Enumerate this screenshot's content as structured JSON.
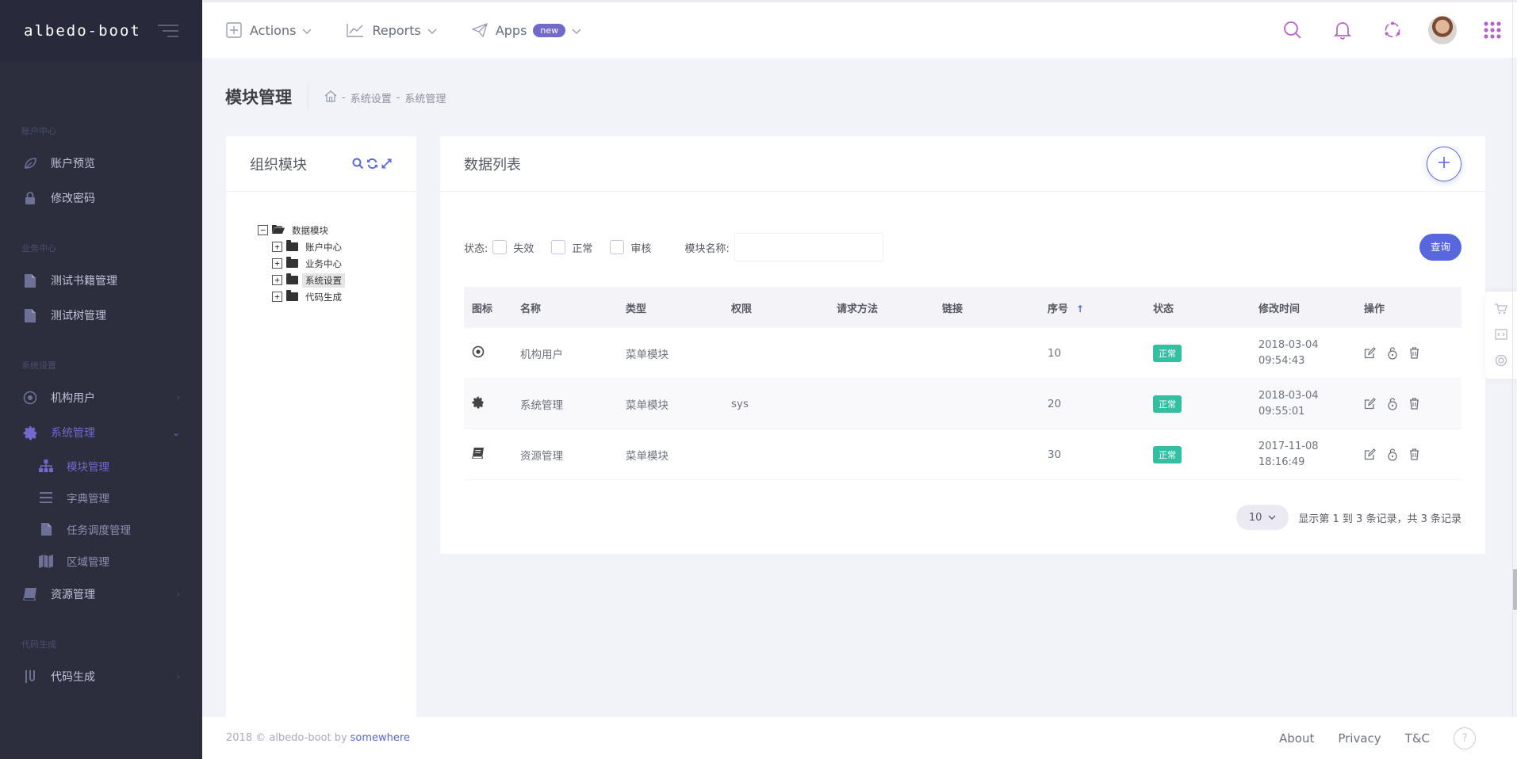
{
  "brand": {
    "name": "albedo-boot"
  },
  "sidebar": {
    "sections": [
      {
        "title": "账户中心",
        "items": [
          {
            "label": "账户预览",
            "icon": "leaf-icon"
          },
          {
            "label": "修改密码",
            "icon": "lock-icon"
          }
        ]
      },
      {
        "title": "业务中心",
        "items": [
          {
            "label": "测试书籍管理",
            "icon": "file-icon"
          },
          {
            "label": "测试树管理",
            "icon": "file-icon"
          }
        ]
      },
      {
        "title": "系统设置",
        "items": [
          {
            "label": "机构用户",
            "icon": "target-icon"
          },
          {
            "label": "系统管理",
            "icon": "gear-icon"
          }
        ]
      },
      {
        "title": "代码生成",
        "items": [
          {
            "label": "代码生成",
            "icon": "code-icon"
          }
        ]
      }
    ],
    "submenu": [
      {
        "label": "模块管理",
        "icon": "sitemap-icon"
      },
      {
        "label": "字典管理",
        "icon": "list-icon"
      },
      {
        "label": "任务调度管理",
        "icon": "file-icon"
      },
      {
        "label": "区域管理",
        "icon": "map-icon"
      }
    ],
    "resource": {
      "label": "资源管理",
      "icon": "book-icon"
    }
  },
  "header": {
    "menus": [
      {
        "label": "Actions",
        "icon": "add-square-icon"
      },
      {
        "label": "Reports",
        "icon": "chart-icon"
      },
      {
        "label": "Apps",
        "icon": "paper-plane-icon",
        "badge": "new"
      }
    ],
    "tools": [
      "search-icon",
      "bell-icon",
      "network-icon",
      "avatar",
      "apps-grid-icon"
    ]
  },
  "subheader": {
    "title": "模块管理",
    "crumbs": [
      "系统设置",
      "系统管理"
    ],
    "separator": "-"
  },
  "tree_panel": {
    "title": "组织模块",
    "root": {
      "label": "数据模块",
      "toggle": "−"
    },
    "children": [
      {
        "label": "账户中心",
        "toggle": "+"
      },
      {
        "label": "业务中心",
        "toggle": "+"
      },
      {
        "label": "系统设置",
        "toggle": "+"
      },
      {
        "label": "代码生成",
        "toggle": "+"
      }
    ]
  },
  "list_panel": {
    "title": "数据列表",
    "filters": {
      "status_label": "状态:",
      "options": [
        "失效",
        "正常",
        "审核"
      ],
      "name_label": "模块名称:",
      "name_value": "",
      "query_button": "查询"
    },
    "columns": [
      "图标",
      "名称",
      "类型",
      "权限",
      "请求方法",
      "链接",
      "序号",
      "状态",
      "修改时间",
      "操作"
    ],
    "rows": [
      {
        "icon": "dot-circle-icon",
        "name": "机构用户",
        "type": "菜单模块",
        "permission": "",
        "method": "",
        "link": "",
        "order": "10",
        "status": "正常",
        "time1": "2018-03-04",
        "time2": "09:54:43"
      },
      {
        "icon": "gear-icon",
        "name": "系统管理",
        "type": "菜单模块",
        "permission": "sys",
        "method": "",
        "link": "",
        "order": "20",
        "status": "正常",
        "time1": "2018-03-04",
        "time2": "09:55:01"
      },
      {
        "icon": "book-icon",
        "name": "资源管理",
        "type": "菜单模块",
        "permission": "",
        "method": "",
        "link": "",
        "order": "30",
        "status": "正常",
        "time1": "2017-11-08",
        "time2": "18:16:49"
      }
    ],
    "pager": {
      "page_size": "10",
      "summary": "显示第 1 到 3 条记录，共 3 条记录"
    }
  },
  "footer": {
    "copyright": "2018 © albedo-boot by",
    "author": "somewhere",
    "links": [
      "About",
      "Privacy",
      "T&C"
    ],
    "help": "?"
  },
  "colors": {
    "accent": "#716aca",
    "primary": "#5867dd",
    "success": "#34bfa3",
    "sidebar_bg": "#2c2e3e"
  }
}
